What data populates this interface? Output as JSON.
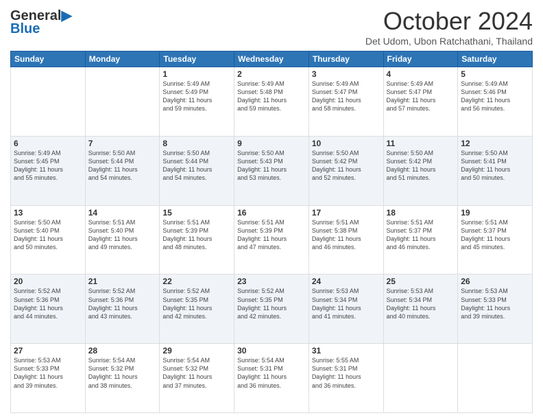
{
  "logo": {
    "line1": "General",
    "line2": "Blue"
  },
  "header": {
    "month": "October 2024",
    "location": "Det Udom, Ubon Ratchathani, Thailand"
  },
  "weekdays": [
    "Sunday",
    "Monday",
    "Tuesday",
    "Wednesday",
    "Thursday",
    "Friday",
    "Saturday"
  ],
  "weeks": [
    [
      {
        "day": "",
        "info": ""
      },
      {
        "day": "",
        "info": ""
      },
      {
        "day": "1",
        "info": "Sunrise: 5:49 AM\nSunset: 5:49 PM\nDaylight: 11 hours\nand 59 minutes."
      },
      {
        "day": "2",
        "info": "Sunrise: 5:49 AM\nSunset: 5:48 PM\nDaylight: 11 hours\nand 59 minutes."
      },
      {
        "day": "3",
        "info": "Sunrise: 5:49 AM\nSunset: 5:47 PM\nDaylight: 11 hours\nand 58 minutes."
      },
      {
        "day": "4",
        "info": "Sunrise: 5:49 AM\nSunset: 5:47 PM\nDaylight: 11 hours\nand 57 minutes."
      },
      {
        "day": "5",
        "info": "Sunrise: 5:49 AM\nSunset: 5:46 PM\nDaylight: 11 hours\nand 56 minutes."
      }
    ],
    [
      {
        "day": "6",
        "info": "Sunrise: 5:49 AM\nSunset: 5:45 PM\nDaylight: 11 hours\nand 55 minutes."
      },
      {
        "day": "7",
        "info": "Sunrise: 5:50 AM\nSunset: 5:44 PM\nDaylight: 11 hours\nand 54 minutes."
      },
      {
        "day": "8",
        "info": "Sunrise: 5:50 AM\nSunset: 5:44 PM\nDaylight: 11 hours\nand 54 minutes."
      },
      {
        "day": "9",
        "info": "Sunrise: 5:50 AM\nSunset: 5:43 PM\nDaylight: 11 hours\nand 53 minutes."
      },
      {
        "day": "10",
        "info": "Sunrise: 5:50 AM\nSunset: 5:42 PM\nDaylight: 11 hours\nand 52 minutes."
      },
      {
        "day": "11",
        "info": "Sunrise: 5:50 AM\nSunset: 5:42 PM\nDaylight: 11 hours\nand 51 minutes."
      },
      {
        "day": "12",
        "info": "Sunrise: 5:50 AM\nSunset: 5:41 PM\nDaylight: 11 hours\nand 50 minutes."
      }
    ],
    [
      {
        "day": "13",
        "info": "Sunrise: 5:50 AM\nSunset: 5:40 PM\nDaylight: 11 hours\nand 50 minutes."
      },
      {
        "day": "14",
        "info": "Sunrise: 5:51 AM\nSunset: 5:40 PM\nDaylight: 11 hours\nand 49 minutes."
      },
      {
        "day": "15",
        "info": "Sunrise: 5:51 AM\nSunset: 5:39 PM\nDaylight: 11 hours\nand 48 minutes."
      },
      {
        "day": "16",
        "info": "Sunrise: 5:51 AM\nSunset: 5:39 PM\nDaylight: 11 hours\nand 47 minutes."
      },
      {
        "day": "17",
        "info": "Sunrise: 5:51 AM\nSunset: 5:38 PM\nDaylight: 11 hours\nand 46 minutes."
      },
      {
        "day": "18",
        "info": "Sunrise: 5:51 AM\nSunset: 5:37 PM\nDaylight: 11 hours\nand 46 minutes."
      },
      {
        "day": "19",
        "info": "Sunrise: 5:51 AM\nSunset: 5:37 PM\nDaylight: 11 hours\nand 45 minutes."
      }
    ],
    [
      {
        "day": "20",
        "info": "Sunrise: 5:52 AM\nSunset: 5:36 PM\nDaylight: 11 hours\nand 44 minutes."
      },
      {
        "day": "21",
        "info": "Sunrise: 5:52 AM\nSunset: 5:36 PM\nDaylight: 11 hours\nand 43 minutes."
      },
      {
        "day": "22",
        "info": "Sunrise: 5:52 AM\nSunset: 5:35 PM\nDaylight: 11 hours\nand 42 minutes."
      },
      {
        "day": "23",
        "info": "Sunrise: 5:52 AM\nSunset: 5:35 PM\nDaylight: 11 hours\nand 42 minutes."
      },
      {
        "day": "24",
        "info": "Sunrise: 5:53 AM\nSunset: 5:34 PM\nDaylight: 11 hours\nand 41 minutes."
      },
      {
        "day": "25",
        "info": "Sunrise: 5:53 AM\nSunset: 5:34 PM\nDaylight: 11 hours\nand 40 minutes."
      },
      {
        "day": "26",
        "info": "Sunrise: 5:53 AM\nSunset: 5:33 PM\nDaylight: 11 hours\nand 39 minutes."
      }
    ],
    [
      {
        "day": "27",
        "info": "Sunrise: 5:53 AM\nSunset: 5:33 PM\nDaylight: 11 hours\nand 39 minutes."
      },
      {
        "day": "28",
        "info": "Sunrise: 5:54 AM\nSunset: 5:32 PM\nDaylight: 11 hours\nand 38 minutes."
      },
      {
        "day": "29",
        "info": "Sunrise: 5:54 AM\nSunset: 5:32 PM\nDaylight: 11 hours\nand 37 minutes."
      },
      {
        "day": "30",
        "info": "Sunrise: 5:54 AM\nSunset: 5:31 PM\nDaylight: 11 hours\nand 36 minutes."
      },
      {
        "day": "31",
        "info": "Sunrise: 5:55 AM\nSunset: 5:31 PM\nDaylight: 11 hours\nand 36 minutes."
      },
      {
        "day": "",
        "info": ""
      },
      {
        "day": "",
        "info": ""
      }
    ]
  ]
}
